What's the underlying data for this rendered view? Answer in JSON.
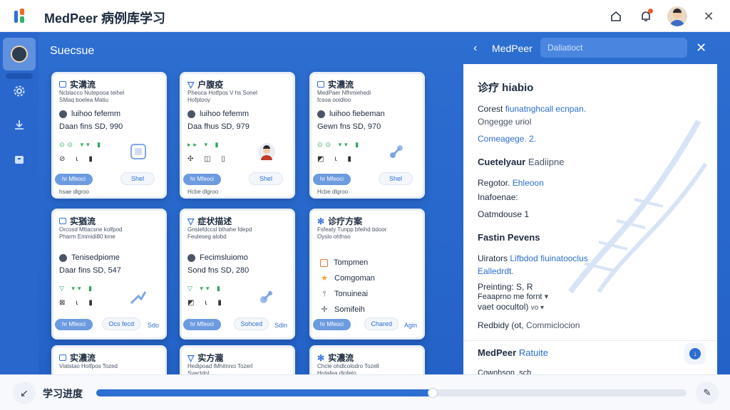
{
  "app": {
    "title": "MedPeer 病例库学习"
  },
  "section": {
    "title": "Suecsue"
  },
  "colors": {
    "accent": "#2d6ed1",
    "brand_orange": "#f06b2a",
    "brand_green": "#2fb06a"
  },
  "cards": [
    {
      "title": "实溝流",
      "sub": "Ncblacco Nutepooa teihel\nSMaq boelea Matiu",
      "name": "luihoo fefemm",
      "meta": "Daan fins SD, 990",
      "pill_left": "hr Mfeoci",
      "pill_right": "Shel",
      "foot": "hsae dlgroo"
    },
    {
      "title": "户腹疫",
      "sub": "Pheoca Hotfpos V hs Sonel\nHofptooy",
      "name": "luihoo fefemm",
      "meta": "Daa fhus SD, 979",
      "pill_left": "hr Mfeoci",
      "pill_right": "Shel",
      "foot": "Hcbe dlgroo"
    },
    {
      "title": "实濃流",
      "sub": "MedPaer Nfhmiehedi\nfcsoa ooidloo",
      "name": "luihoo fiebeman",
      "meta": "Gewn fns SD, 970",
      "pill_left": "hr Mfeoci",
      "pill_right": "Shel",
      "foot": "Hcbe dlgroo"
    },
    {
      "title": "实猶流",
      "sub": "Orcosd Mttacsne kolfpod\nPharm Emmidi80 kme",
      "name": "Tenisedpiome",
      "meta": "Daar fins SD, 547",
      "pill_left": "hr Mfeoci",
      "pill_right": "Ocs fecd",
      "right_extra": "Sdo",
      "foot": ""
    },
    {
      "title": "症状描述",
      "sub": "Gnslefdccsl bthahe fdepd\nFeuleseg alobd",
      "name": "Fecimsluiomo",
      "meta": "Sond fns SD, 280",
      "pill_left": "hr Mfeoci",
      "pill_right": "Sohced",
      "right_extra": "Sdin",
      "foot": ""
    },
    {
      "title": "诊疗方案",
      "sub": "Fsfeaty Tunpp bfeihd bdoor\nOyslo ohfnso",
      "list": [
        {
          "icon": "square",
          "text": "Tompmen"
        },
        {
          "icon": "star",
          "text": "Comgoman"
        },
        {
          "icon": "test-tube",
          "text": "Tonuineai"
        },
        {
          "icon": "plus",
          "text": "Somifeih"
        }
      ],
      "pill_left": "hr Mfeoci",
      "pill_right": "Chared",
      "right_extra": "Agin",
      "foot": ""
    },
    {
      "title": "实濃流",
      "sub": "Viatstao Hotfpos Tozed",
      "name": "",
      "meta": "",
      "pill_left": "",
      "pill_right": "",
      "foot": ""
    },
    {
      "title": "实方瀧",
      "sub": "Hedipoad lMhitnnci Tozerl\nSyecldnl",
      "name": "",
      "meta": "",
      "pill_left": "",
      "pill_right": "",
      "foot": ""
    },
    {
      "title": "实濃流",
      "sub": "Chcle ohdlcolodro Tozell\nHrdafea dlofeto",
      "name": "",
      "meta": "",
      "pill_left": "",
      "pill_right": "",
      "foot": ""
    }
  ],
  "panel": {
    "header_title": "MedPeer",
    "search_placeholder": "Daliatioct",
    "title": "诊疗 hiabio",
    "rows": [
      {
        "label": "Corest",
        "value": "fiunatnghcall ecnpan."
      },
      {
        "label": "Ongegge uriol",
        "value": ""
      },
      {
        "label": "Comeagege. 2.",
        "value": ""
      },
      {
        "label": "Cuetelyaur",
        "value": "Eadiipne"
      },
      {
        "label": "Regotor.",
        "value": "Ehleoon"
      },
      {
        "label": "Inafoenae:",
        "value": ""
      },
      {
        "label": "Oatmdouse 1",
        "value": ""
      },
      {
        "label": "Fastin Pevens",
        "value": ""
      },
      {
        "label": "Uirators",
        "value": "Lifbdod fiuinatooclus"
      },
      {
        "label": "Ealledrdt.",
        "value": ""
      },
      {
        "label": "Preinting: S, R",
        "value": ""
      },
      {
        "label": "Feaaprno me fornt",
        "value": "▾"
      },
      {
        "label": "vaet oocultol)",
        "value": "vo ▾"
      },
      {
        "label": "Redbidy (ot,",
        "value": "Commiclocion"
      }
    ],
    "footer_label": "MedPeer",
    "footer_link": "Ratuite",
    "footer_cut": "Cowohson .sch"
  },
  "bottom": {
    "label": "学习进度",
    "progress": 0.57
  }
}
